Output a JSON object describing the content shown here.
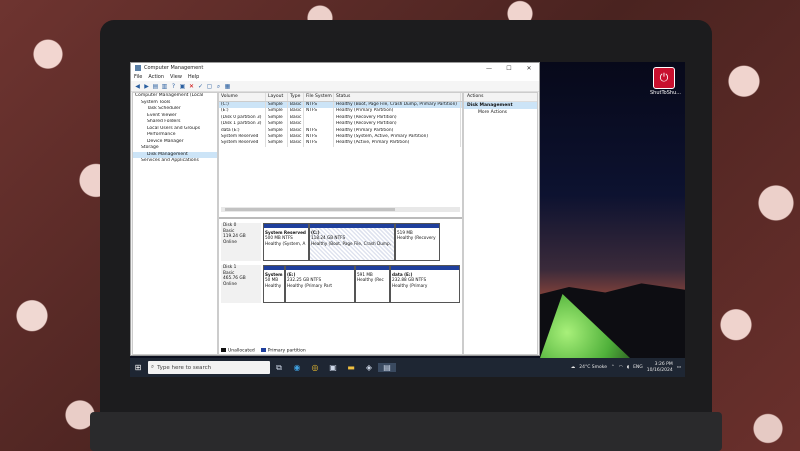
{
  "window": {
    "title": "Computer Management",
    "controls": [
      "—",
      "☐",
      "✕"
    ]
  },
  "menu": [
    "File",
    "Action",
    "View",
    "Help"
  ],
  "tree": {
    "items": [
      {
        "label": "Computer Management (Local",
        "indent": 0,
        "sel": false
      },
      {
        "label": "System Tools",
        "indent": 1,
        "sel": false
      },
      {
        "label": "Task Scheduler",
        "indent": 2,
        "sel": false
      },
      {
        "label": "Event Viewer",
        "indent": 2,
        "sel": false
      },
      {
        "label": "Shared Folders",
        "indent": 2,
        "sel": false
      },
      {
        "label": "Local Users and Groups",
        "indent": 2,
        "sel": false
      },
      {
        "label": "Performance",
        "indent": 2,
        "sel": false
      },
      {
        "label": "Device Manager",
        "indent": 2,
        "sel": false
      },
      {
        "label": "Storage",
        "indent": 1,
        "sel": false
      },
      {
        "label": "Disk Management",
        "indent": 2,
        "sel": true
      },
      {
        "label": "Services and Applications",
        "indent": 1,
        "sel": false
      }
    ]
  },
  "volumes": {
    "headers": [
      "Volume",
      "Layout",
      "Type",
      "File System",
      "Status"
    ],
    "rows": [
      [
        "(C:)",
        "Simple",
        "Basic",
        "NTFS",
        "Healthy (Boot, Page File, Crash Dump, Primary Partition)"
      ],
      [
        "(E:)",
        "Simple",
        "Basic",
        "NTFS",
        "Healthy (Primary Partition)"
      ],
      [
        "(Disk 0 partition 3)",
        "Simple",
        "Basic",
        "",
        "Healthy (Recovery Partition)"
      ],
      [
        "(Disk 1 partition 3)",
        "Simple",
        "Basic",
        "",
        "Healthy (Recovery Partition)"
      ],
      [
        "data (E:)",
        "Simple",
        "Basic",
        "NTFS",
        "Healthy (Primary Partition)"
      ],
      [
        "System Reserved",
        "Simple",
        "Basic",
        "NTFS",
        "Healthy (System, Active, Primary Partition)"
      ],
      [
        "System Reserved",
        "Simple",
        "Basic",
        "NTFS",
        "Healthy (Active, Primary Partition)"
      ]
    ]
  },
  "disk0": {
    "name": "Disk 0",
    "type": "Basic",
    "size": "119.24 GB",
    "status": "Online",
    "parts": [
      {
        "name": "System Reserved",
        "size": "500 MB NTFS",
        "status": "Healthy (System, A"
      },
      {
        "name": "(C:)",
        "size": "118.24 GB NTFS",
        "status": "Healthy (Boot, Page File, Crash Dump,"
      },
      {
        "name": "",
        "size": "519 MB",
        "status": "Healthy (Recovery"
      }
    ]
  },
  "disk1": {
    "name": "Disk 1",
    "type": "Basic",
    "size": "465.76 GB",
    "status": "Online",
    "parts": [
      {
        "name": "System",
        "size": "50 MB",
        "status": "Healthy"
      },
      {
        "name": "(E:)",
        "size": "232.25 GB NTFS",
        "status": "Healthy (Primary Part"
      },
      {
        "name": "",
        "size": "591 MB",
        "status": "Healthy (Rec"
      },
      {
        "name": "data (E:)",
        "size": "232.88 GB NTFS",
        "status": "Healthy (Primary"
      }
    ]
  },
  "legend": {
    "unallocated": "Unallocated",
    "primary": "Primary partition"
  },
  "actions": {
    "header": "Actions",
    "selected": "Disk Management",
    "more": "More Actions"
  },
  "taskbar": {
    "search_placeholder": "Type here to search",
    "weather": "24°C  Smoke",
    "lang": "ENG",
    "time": "3:26 PM",
    "date": "10/16/2024"
  },
  "desktop_icon": {
    "label": "ShutToShu..."
  },
  "colors": {
    "partition_bar": "#1f3f9c",
    "selection": "#cce4f7",
    "taskbar": "#1e2633"
  }
}
